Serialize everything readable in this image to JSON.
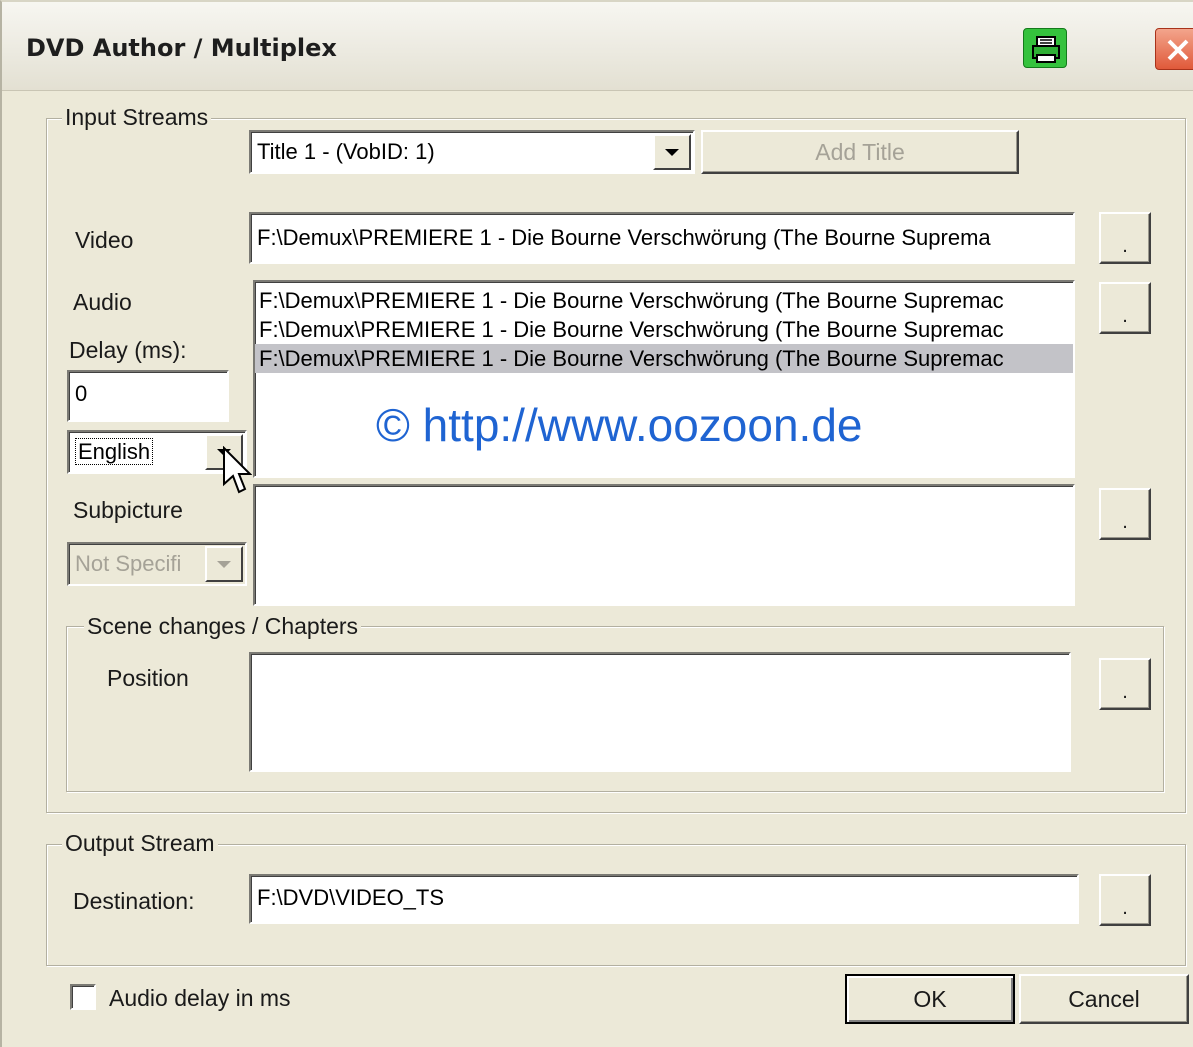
{
  "window": {
    "title": "DVD Author / Multiplex",
    "print_icon": "printer-icon",
    "close_icon": "close-icon"
  },
  "input_streams": {
    "legend": "Input Streams",
    "title_select": "Title 1 - (VobID: 1)",
    "add_title_label": "Add Title",
    "video_label": "Video",
    "video_path": "F:\\Demux\\PREMIERE 1 - Die Bourne Verschwörung (The Bourne Suprema",
    "browse_label": ".",
    "audio_label": "Audio",
    "delay_label": "Delay (ms):",
    "delay_value": "0",
    "language_select": "English",
    "audio_items": [
      "F:\\Demux\\PREMIERE 1 - Die Bourne Verschwörung (The Bourne Supremac",
      "F:\\Demux\\PREMIERE 1 - Die Bourne Verschwörung (The Bourne Supremac",
      "F:\\Demux\\PREMIERE 1 - Die Bourne Verschwörung (The Bourne Supremac"
    ],
    "selected_audio_index": 2,
    "subpicture_label": "Subpicture",
    "subpicture_select": "Not Specifi"
  },
  "watermark": "© http://www.oozoon.de",
  "chapters": {
    "legend": "Scene changes / Chapters",
    "position_label": "Position"
  },
  "output_stream": {
    "legend": "Output Stream",
    "destination_label": "Destination:",
    "destination_value": "F:\\DVD\\VIDEO_TS"
  },
  "footer": {
    "audio_delay_checkbox_label": "Audio delay in ms",
    "audio_delay_checked": false,
    "ok_label": "OK",
    "cancel_label": "Cancel"
  }
}
